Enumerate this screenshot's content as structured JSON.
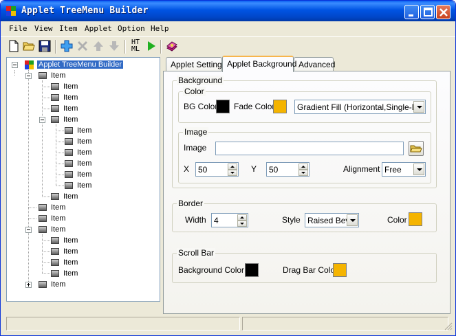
{
  "window": {
    "title": "Applet TreeMenu Builder"
  },
  "menu": [
    "File",
    "View",
    "Item",
    "Applet",
    "Option",
    "Help"
  ],
  "toolbar": {
    "buttons": [
      "new-icon",
      "open-icon",
      "save-icon",
      "add-icon",
      "delete-icon",
      "move-up-icon",
      "move-down-icon",
      "html-icon",
      "run-icon",
      "help-book-icon"
    ],
    "html_label": "HT\nML"
  },
  "tree": {
    "root": "Applet TreeMenu Builder",
    "item_label": "Item"
  },
  "tabs": [
    "Applet Settings",
    "Applet Background",
    "Advanced"
  ],
  "background": {
    "group_label": "Background",
    "color": {
      "group_label": "Color",
      "bg_color_label": "BG Color",
      "bg_color_value": "#000000",
      "fade_color_label": "Fade Color",
      "fade_color_value": "#f5b400",
      "fill_mode": "Gradient Fill (Horizontal,Single-Direc"
    },
    "image": {
      "group_label": "Image",
      "image_label": "Image",
      "image_value": "",
      "x_label": "X",
      "x_value": "50",
      "y_label": "Y",
      "y_value": "50",
      "alignment_label": "Alignment",
      "alignment_value": "Free"
    }
  },
  "border": {
    "group_label": "Border",
    "width_label": "Width",
    "width_value": "4",
    "style_label": "Style",
    "style_value": "Raised Beve",
    "color_label": "Color",
    "color_value": "#f5b400"
  },
  "scrollbar": {
    "group_label": "Scroll Bar",
    "bg_color_label": "Background Color",
    "bg_color_value": "#000000",
    "drag_bar_label": "Drag Bar Color",
    "drag_bar_value": "#f5b400"
  },
  "status": [
    "",
    ""
  ]
}
